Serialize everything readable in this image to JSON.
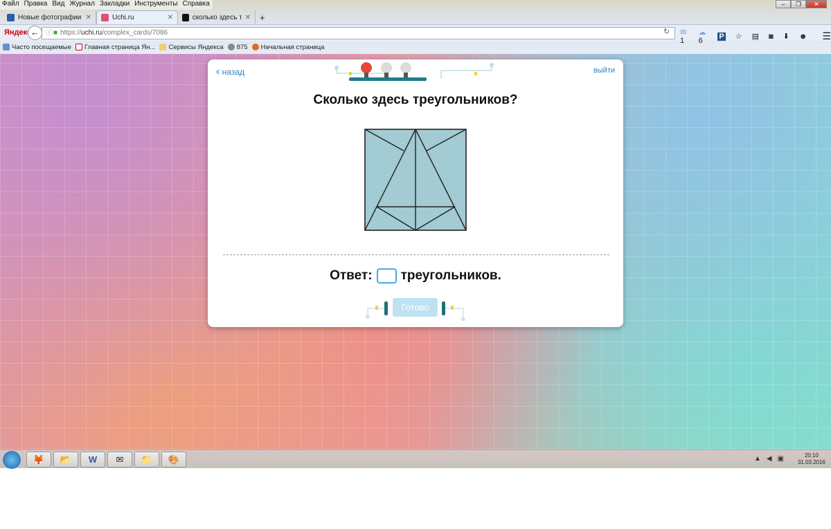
{
  "menu": [
    "Файл",
    "Правка",
    "Вид",
    "Журнал",
    "Закладки",
    "Инструменты",
    "Справка"
  ],
  "tabs": [
    {
      "label": "Новые фотографии",
      "color": "#2b5fa5"
    },
    {
      "label": "Uchi.ru",
      "color": "#e05070"
    },
    {
      "label": "сколько здесь треугольни...",
      "color": "#111"
    }
  ],
  "new_tab": "+",
  "browser_brand": "Яндекс",
  "url_prefix": "https://",
  "url_host": "uchi.ru",
  "url_path": "/complex_cards/7086",
  "toolbar": {
    "mail_count": "1",
    "weather": "6"
  },
  "bookmarks": [
    "Часто посещаемые",
    "Главная страница Ян...",
    "Сервисы Яндекса",
    "875",
    "Начальная страница"
  ],
  "card": {
    "back": "назад",
    "exit": "выйти",
    "question": "Сколько здесь треугольников?",
    "answer_prefix": "Ответ:",
    "answer_suffix": "треугольников.",
    "answer_value": "",
    "done": "Готово",
    "progress": {
      "current": 1,
      "total": 3
    }
  },
  "tray": {
    "time": "20:10",
    "date": "31.03.2016"
  }
}
